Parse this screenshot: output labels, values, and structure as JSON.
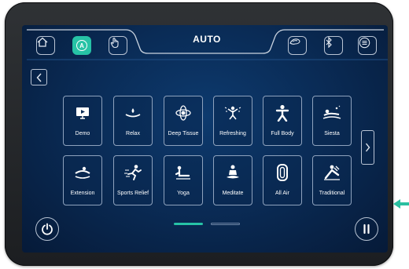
{
  "header": {
    "title": "AUTO",
    "buttons": [
      {
        "name": "home-icon"
      },
      {
        "name": "auto-mode-icon",
        "glyph": "A",
        "active": true
      },
      {
        "name": "manual-hand-icon"
      },
      {
        "name": "foot-massage-icon"
      },
      {
        "name": "bluetooth-icon",
        "glyph": "✱"
      },
      {
        "name": "menu-list-icon"
      }
    ]
  },
  "programs": [
    {
      "label": "Demo",
      "icon": "demo-icon"
    },
    {
      "label": "Relax",
      "icon": "relax-icon"
    },
    {
      "label": "Deep Tissue",
      "icon": "deep-tissue-icon"
    },
    {
      "label": "Refreshing",
      "icon": "refreshing-icon"
    },
    {
      "label": "Full Body",
      "icon": "full-body-icon"
    },
    {
      "label": "Siesta",
      "icon": "siesta-icon"
    },
    {
      "label": "Extension",
      "icon": "extension-icon"
    },
    {
      "label": "Sports Relief",
      "icon": "sports-relief-icon"
    },
    {
      "label": "Yoga",
      "icon": "yoga-icon"
    },
    {
      "label": "Meditate",
      "icon": "meditate-icon"
    },
    {
      "label": "All Air",
      "icon": "all-air-icon"
    },
    {
      "label": "Traditional",
      "icon": "traditional-icon"
    }
  ],
  "pagination": {
    "pages": 2,
    "current": 1
  },
  "colors": {
    "accent": "#27c3a6",
    "panel": "#0a2c57",
    "outline": "#b9c4d4",
    "pointer": "#2bbfa0"
  }
}
